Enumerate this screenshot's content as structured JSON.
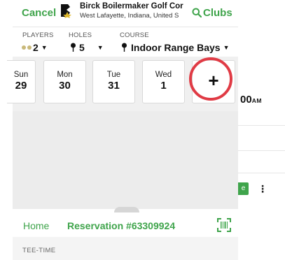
{
  "header": {
    "cancel_label": "Cancel",
    "course_name": "Birck Boilermaker Golf Cor",
    "course_location": "West Lafayette, Indiana, United S",
    "clubs_label": "Clubs"
  },
  "filters": {
    "players": {
      "label": "PLAYERS",
      "value": "2"
    },
    "holes": {
      "label": "HOLES",
      "value": "5"
    },
    "course": {
      "label": "COURSE",
      "value": "Indoor Range Bays"
    }
  },
  "dates": [
    {
      "day": "Sun",
      "date": "29"
    },
    {
      "day": "Mon",
      "date": "30"
    },
    {
      "day": "Tue",
      "date": "31"
    },
    {
      "day": "Wed",
      "date": "1"
    }
  ],
  "add_date_label": "+",
  "tee_time_partial": {
    "time": "00",
    "ampm": "AM"
  },
  "more_label": "⋮",
  "bottom": {
    "home_label": "Home",
    "reservation_label": "Reservation #63309924",
    "section_label": "TEE-TIME"
  },
  "colors": {
    "accent": "#3fa44b",
    "highlight_circle": "#e03b45"
  }
}
